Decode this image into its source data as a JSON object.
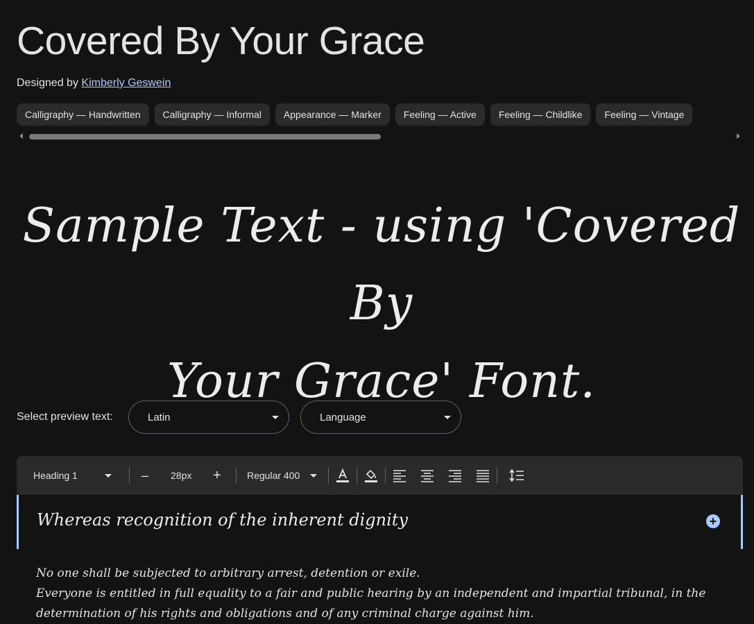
{
  "font": {
    "title": "Covered By Your Grace",
    "designed_by_prefix": "Designed by",
    "designer": "Kimberly Geswein"
  },
  "tags": [
    "Calligraphy — Handwritten",
    "Calligraphy — Informal",
    "Appearance — Marker",
    "Feeling — Active",
    "Feeling — Childlike",
    "Feeling — Vintage"
  ],
  "sample": {
    "line1": "Sample Text - using 'Covered By",
    "line2": "Your Grace' Font."
  },
  "preview_select": {
    "label": "Select preview text:",
    "script_value": "Latin",
    "language_value": "Language"
  },
  "toolbar": {
    "style_value": "Heading 1",
    "size_value": "28px",
    "decrease_label": "–",
    "increase_label": "+",
    "weight_value": "Regular 400"
  },
  "preview": {
    "heading_text": "Whereas recognition of the inherent dignity",
    "body_lines": [
      "No one shall be subjected to arbitrary arrest, detention or exile.",
      "Everyone is entitled in full equality to a fair and public hearing by an independent and impartial tribunal, in the",
      "determination of his rights and obligations and of any criminal charge against him."
    ]
  },
  "colors": {
    "background": "#131314",
    "accent": "#a8c7fa",
    "chip_bg": "#2b2b2c",
    "toolbar_bg": "#2a2a2b"
  }
}
